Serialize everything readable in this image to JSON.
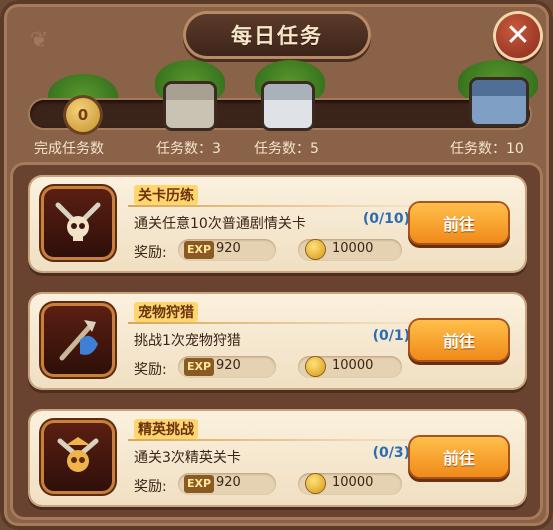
{
  "header": {
    "title": "每日任务",
    "close_icon": "close-icon"
  },
  "progress": {
    "current": "0",
    "completed_label": "完成任务数",
    "milestones": [
      {
        "label": "任务数：3",
        "chest": "stone-chest-icon"
      },
      {
        "label": "任务数：5",
        "chest": "silver-chest-icon"
      },
      {
        "label": "任务数：10",
        "chest": "blue-chest-icon"
      }
    ]
  },
  "tasks": [
    {
      "name": "关卡历练",
      "desc": "通关任意10次普通剧情关卡",
      "progress": "(0/10)",
      "reward_label": "奖励:",
      "exp_tag": "EXP",
      "exp": "920",
      "gold": "10000",
      "button": "前往",
      "icon": "skull-crossed-axes-icon"
    },
    {
      "name": "宠物狩猎",
      "desc": "挑战1次宠物狩猎",
      "progress": "(0/1)",
      "reward_label": "奖励:",
      "exp_tag": "EXP",
      "exp": "920",
      "gold": "10000",
      "button": "前往",
      "icon": "pet-hunt-spear-icon"
    },
    {
      "name": "精英挑战",
      "desc": "通关3次精英关卡",
      "progress": "(0/3)",
      "reward_label": "奖励:",
      "exp_tag": "EXP",
      "exp": "920",
      "gold": "10000",
      "button": "前往",
      "icon": "elite-skull-icon"
    }
  ],
  "colors": {
    "accent": "#f08a1a",
    "progress_text": "#2a6db3"
  }
}
